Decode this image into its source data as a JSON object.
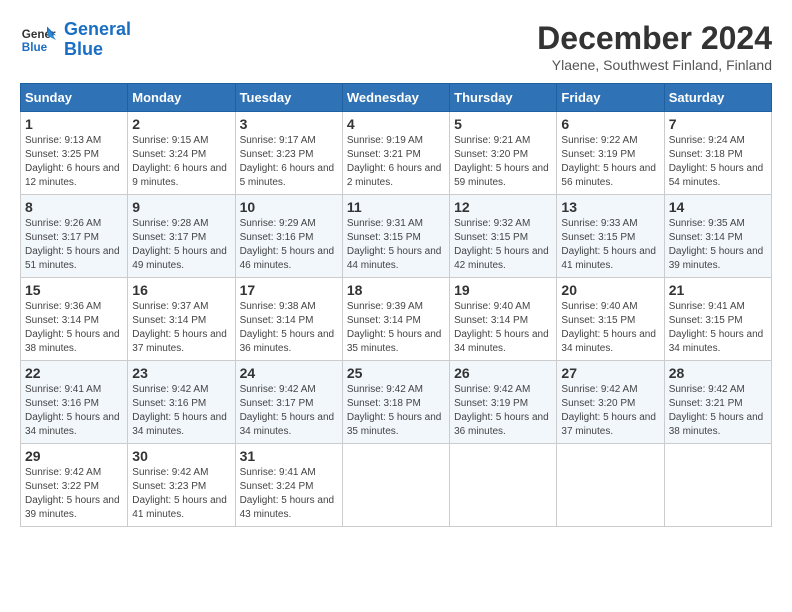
{
  "header": {
    "logo_line1": "General",
    "logo_line2": "Blue",
    "title": "December 2024",
    "subtitle": "Ylaene, Southwest Finland, Finland"
  },
  "days_of_week": [
    "Sunday",
    "Monday",
    "Tuesday",
    "Wednesday",
    "Thursday",
    "Friday",
    "Saturday"
  ],
  "weeks": [
    [
      {
        "day": "1",
        "sunrise": "9:13 AM",
        "sunset": "3:25 PM",
        "daylight": "6 hours and 12 minutes."
      },
      {
        "day": "2",
        "sunrise": "9:15 AM",
        "sunset": "3:24 PM",
        "daylight": "6 hours and 9 minutes."
      },
      {
        "day": "3",
        "sunrise": "9:17 AM",
        "sunset": "3:23 PM",
        "daylight": "6 hours and 5 minutes."
      },
      {
        "day": "4",
        "sunrise": "9:19 AM",
        "sunset": "3:21 PM",
        "daylight": "6 hours and 2 minutes."
      },
      {
        "day": "5",
        "sunrise": "9:21 AM",
        "sunset": "3:20 PM",
        "daylight": "5 hours and 59 minutes."
      },
      {
        "day": "6",
        "sunrise": "9:22 AM",
        "sunset": "3:19 PM",
        "daylight": "5 hours and 56 minutes."
      },
      {
        "day": "7",
        "sunrise": "9:24 AM",
        "sunset": "3:18 PM",
        "daylight": "5 hours and 54 minutes."
      }
    ],
    [
      {
        "day": "8",
        "sunrise": "9:26 AM",
        "sunset": "3:17 PM",
        "daylight": "5 hours and 51 minutes."
      },
      {
        "day": "9",
        "sunrise": "9:28 AM",
        "sunset": "3:17 PM",
        "daylight": "5 hours and 49 minutes."
      },
      {
        "day": "10",
        "sunrise": "9:29 AM",
        "sunset": "3:16 PM",
        "daylight": "5 hours and 46 minutes."
      },
      {
        "day": "11",
        "sunrise": "9:31 AM",
        "sunset": "3:15 PM",
        "daylight": "5 hours and 44 minutes."
      },
      {
        "day": "12",
        "sunrise": "9:32 AM",
        "sunset": "3:15 PM",
        "daylight": "5 hours and 42 minutes."
      },
      {
        "day": "13",
        "sunrise": "9:33 AM",
        "sunset": "3:15 PM",
        "daylight": "5 hours and 41 minutes."
      },
      {
        "day": "14",
        "sunrise": "9:35 AM",
        "sunset": "3:14 PM",
        "daylight": "5 hours and 39 minutes."
      }
    ],
    [
      {
        "day": "15",
        "sunrise": "9:36 AM",
        "sunset": "3:14 PM",
        "daylight": "5 hours and 38 minutes."
      },
      {
        "day": "16",
        "sunrise": "9:37 AM",
        "sunset": "3:14 PM",
        "daylight": "5 hours and 37 minutes."
      },
      {
        "day": "17",
        "sunrise": "9:38 AM",
        "sunset": "3:14 PM",
        "daylight": "5 hours and 36 minutes."
      },
      {
        "day": "18",
        "sunrise": "9:39 AM",
        "sunset": "3:14 PM",
        "daylight": "5 hours and 35 minutes."
      },
      {
        "day": "19",
        "sunrise": "9:40 AM",
        "sunset": "3:14 PM",
        "daylight": "5 hours and 34 minutes."
      },
      {
        "day": "20",
        "sunrise": "9:40 AM",
        "sunset": "3:15 PM",
        "daylight": "5 hours and 34 minutes."
      },
      {
        "day": "21",
        "sunrise": "9:41 AM",
        "sunset": "3:15 PM",
        "daylight": "5 hours and 34 minutes."
      }
    ],
    [
      {
        "day": "22",
        "sunrise": "9:41 AM",
        "sunset": "3:16 PM",
        "daylight": "5 hours and 34 minutes."
      },
      {
        "day": "23",
        "sunrise": "9:42 AM",
        "sunset": "3:16 PM",
        "daylight": "5 hours and 34 minutes."
      },
      {
        "day": "24",
        "sunrise": "9:42 AM",
        "sunset": "3:17 PM",
        "daylight": "5 hours and 34 minutes."
      },
      {
        "day": "25",
        "sunrise": "9:42 AM",
        "sunset": "3:18 PM",
        "daylight": "5 hours and 35 minutes."
      },
      {
        "day": "26",
        "sunrise": "9:42 AM",
        "sunset": "3:19 PM",
        "daylight": "5 hours and 36 minutes."
      },
      {
        "day": "27",
        "sunrise": "9:42 AM",
        "sunset": "3:20 PM",
        "daylight": "5 hours and 37 minutes."
      },
      {
        "day": "28",
        "sunrise": "9:42 AM",
        "sunset": "3:21 PM",
        "daylight": "5 hours and 38 minutes."
      }
    ],
    [
      {
        "day": "29",
        "sunrise": "9:42 AM",
        "sunset": "3:22 PM",
        "daylight": "5 hours and 39 minutes."
      },
      {
        "day": "30",
        "sunrise": "9:42 AM",
        "sunset": "3:23 PM",
        "daylight": "5 hours and 41 minutes."
      },
      {
        "day": "31",
        "sunrise": "9:41 AM",
        "sunset": "3:24 PM",
        "daylight": "5 hours and 43 minutes."
      },
      null,
      null,
      null,
      null
    ]
  ]
}
